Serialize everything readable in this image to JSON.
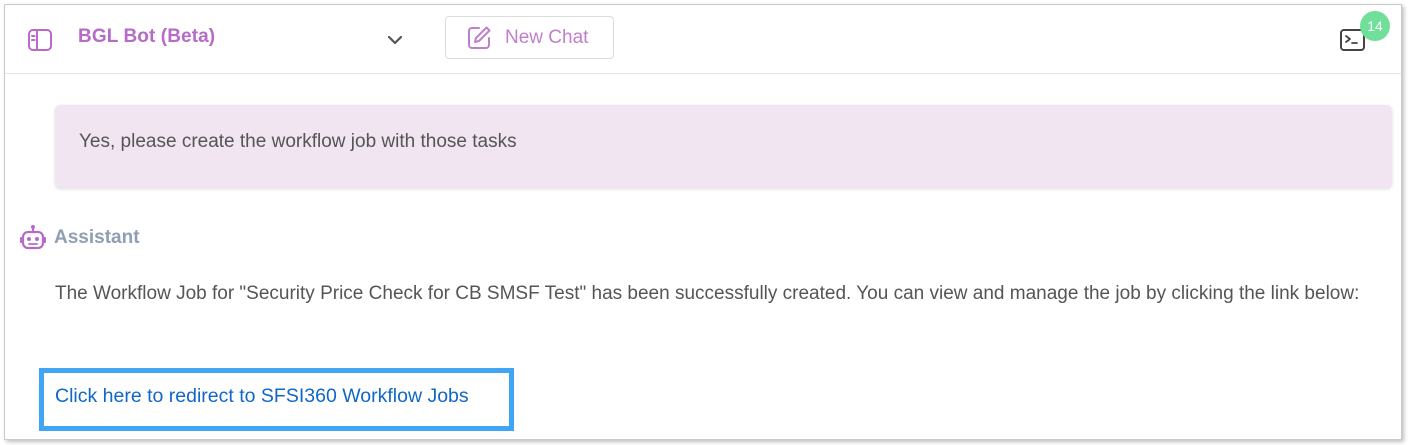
{
  "header": {
    "bot_title": "BGL Bot (Beta)",
    "new_chat_label": "New Chat",
    "notification_count": "14",
    "icons": {
      "sidebar": "sidebar-panel-icon",
      "dropdown": "chevron-down-icon",
      "new_chat": "edit-pencil-icon",
      "terminal": "terminal-icon"
    }
  },
  "conversation": {
    "user_message": "Yes, please create the workflow job with those tasks",
    "assistant_label": "Assistant",
    "assistant_icon": "robot-icon",
    "assistant_message": "The Workflow Job for \"Security Price Check for CB SMSF Test\" has been successfully created. You can view and manage the job by clicking the link below:",
    "link_text": "Click here to redirect to SFSI360 Workflow Jobs"
  },
  "colors": {
    "accent": "#b76bc7",
    "user_bubble": "#f1e5f2",
    "badge": "#6fdf9a",
    "link": "#1167c7",
    "highlight_border": "#40a6f4",
    "assistant_label": "#8f9eb3"
  }
}
